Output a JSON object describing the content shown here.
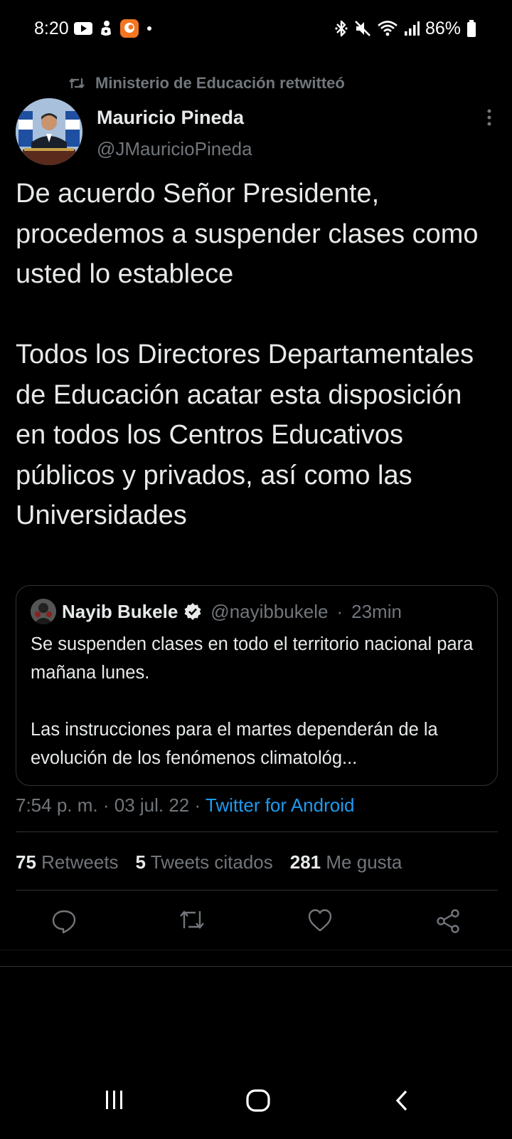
{
  "status_bar": {
    "time": "8:20",
    "battery": "86%"
  },
  "retweet_context": "Ministerio de Educación retwitteó",
  "author": {
    "name": "Mauricio Pineda",
    "handle": "@JMauricioPineda"
  },
  "tweet": {
    "para1": "De acuerdo Señor Presidente, procedemos a suspender clases como usted lo establece",
    "para2": "Todos los Directores Departamentales de Educación acatar esta disposición en todos los Centros Educativos públicos y privados, así como las Universidades"
  },
  "quote": {
    "name": "Nayib Bukele",
    "handle": "@nayibbukele",
    "separator": "·",
    "time": "23min",
    "para1": "Se suspenden clases en todo el territorio nacional para mañana lunes.",
    "para2": "Las instrucciones para el martes dependerán de la evolución de los fenómenos climatológ..."
  },
  "meta": {
    "time": "7:54 p. m.",
    "separator": " · ",
    "date": "03 jul. 22",
    "source": "Twitter for Android"
  },
  "stats": {
    "retweets_count": "75",
    "retweets_label": "Retweets",
    "quotes_count": "5",
    "quotes_label": "Tweets citados",
    "likes_count": "281",
    "likes_label": "Me gusta"
  },
  "colors": {
    "background": "#000000",
    "text": "#e7e9ea",
    "secondary": "#71767b",
    "link": "#1d9bf0",
    "border": "#2f3336"
  }
}
